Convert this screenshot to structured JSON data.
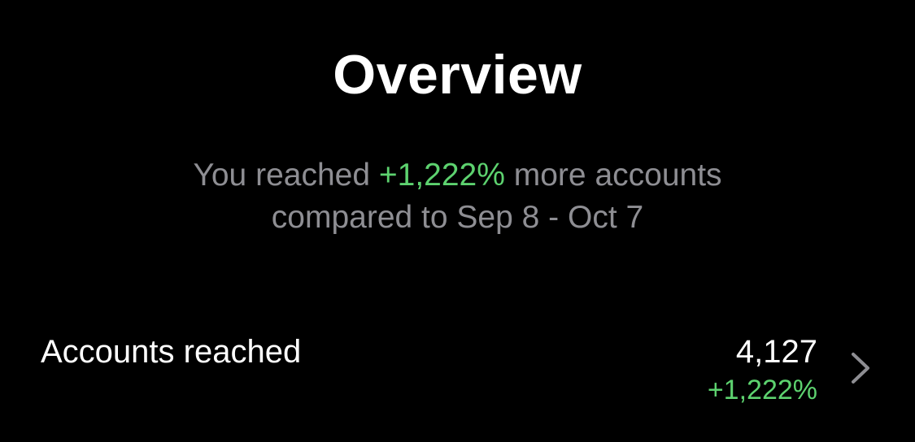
{
  "header": {
    "title": "Overview"
  },
  "summary": {
    "prefix": "You reached ",
    "change": "+1,222%",
    "suffix": " more accounts",
    "comparison": "compared to Sep 8 - Oct 7"
  },
  "metrics": [
    {
      "label": "Accounts reached",
      "value": "4,127",
      "change": "+1,222%",
      "icon": "chevron-right-icon"
    }
  ],
  "colors": {
    "background": "#000000",
    "text_primary": "#ffffff",
    "text_secondary": "#8e8e93",
    "positive": "#5dd26f",
    "chevron": "#8e8e93"
  }
}
